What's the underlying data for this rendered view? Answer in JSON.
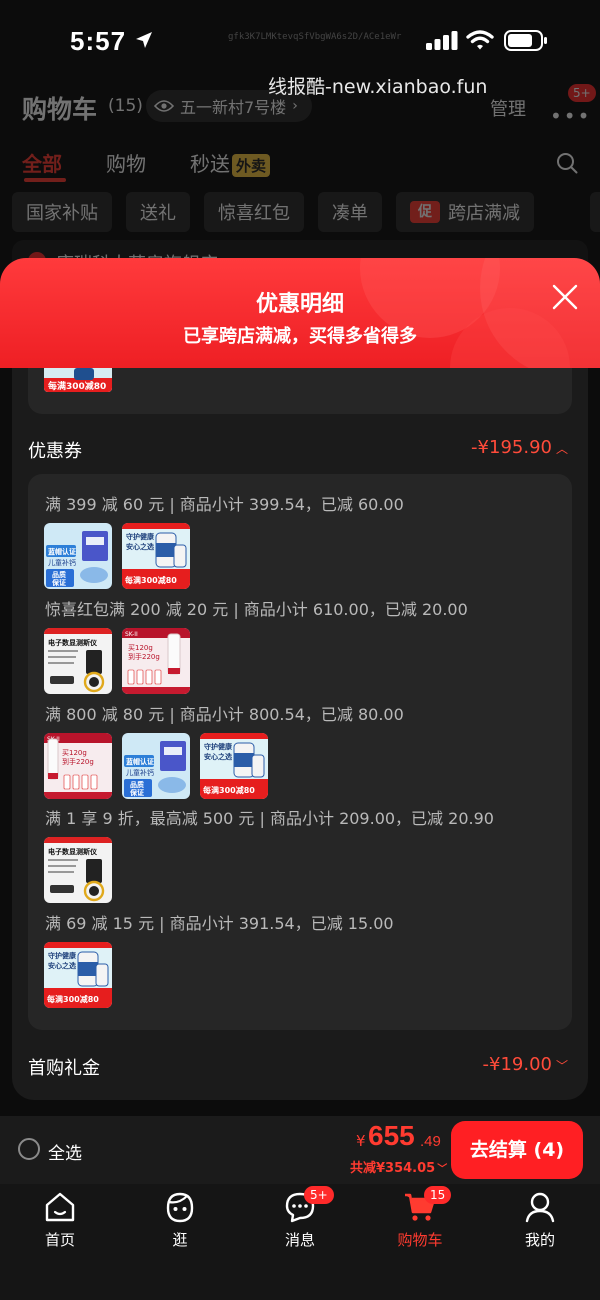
{
  "status_bar": {
    "time": "5:57",
    "code_text": "gfk3K7LMKtevqSfVbgWA6s2D/ACe1eWr"
  },
  "watermark": "线报酷-new.xianbao.fun",
  "header_bg": {
    "title": "购物车",
    "count": "(15)",
    "address": "五一新村7号楼",
    "manage": "管理",
    "more_badge": "5+",
    "tabs": [
      "全部",
      "购物",
      "秒送"
    ],
    "waimai": "外卖",
    "filters": [
      "国家补贴",
      "送礼",
      "惊喜红包",
      "凑单",
      "跨店满减"
    ],
    "cu_label": "促",
    "store_name": "康瑞科大药房旗舰店"
  },
  "popup": {
    "title": "优惠明细",
    "subtitle": "已享跨店满减，买得多省得多",
    "coupon_section": {
      "label": "优惠券",
      "amount": "-¥195.90"
    },
    "coupon_lines": [
      "满 399 减 60 元 | 商品小计 399.54，已减 60.00",
      "惊喜红包满 200 减 20 元 | 商品小计 610.00，已减 20.00",
      "满 800 减 80 元 | 商品小计 800.54，已减 80.00",
      "满 1 享 9 折，最高减 500 元 | 商品小计 209.00，已减 20.90",
      "满 69 减 15 元 | 商品小计 391.54，已减 15.00"
    ],
    "first_buy_section": {
      "label": "首购礼金",
      "amount": "-¥19.00"
    }
  },
  "product_text": {
    "kids_a": "蓝帽认证",
    "kids_b": "儿童补钙",
    "kids_c": "品质",
    "kids_d": "保证",
    "fish_a": "守护健康",
    "fish_b": "安心之选",
    "promo": "每满300减80",
    "scale_title": "电子数显测斯仪",
    "sk2_a": "SK-II",
    "sk2_b": "买120g",
    "sk2_c": "到手220g"
  },
  "checkout": {
    "select_all": "全选",
    "currency": "¥",
    "price_int": "655",
    "price_dec": ".49",
    "saved": "共减¥354.05",
    "button": "去结算 (4)"
  },
  "nav": {
    "items": [
      "首页",
      "逛",
      "消息",
      "购物车",
      "我的"
    ],
    "msg_badge": "5+",
    "cart_badge": "15"
  },
  "colors": {
    "accent": "#ff3b30",
    "header_red": "#ee1f24",
    "card": "#262626",
    "sheet": "#1b1b1b"
  }
}
